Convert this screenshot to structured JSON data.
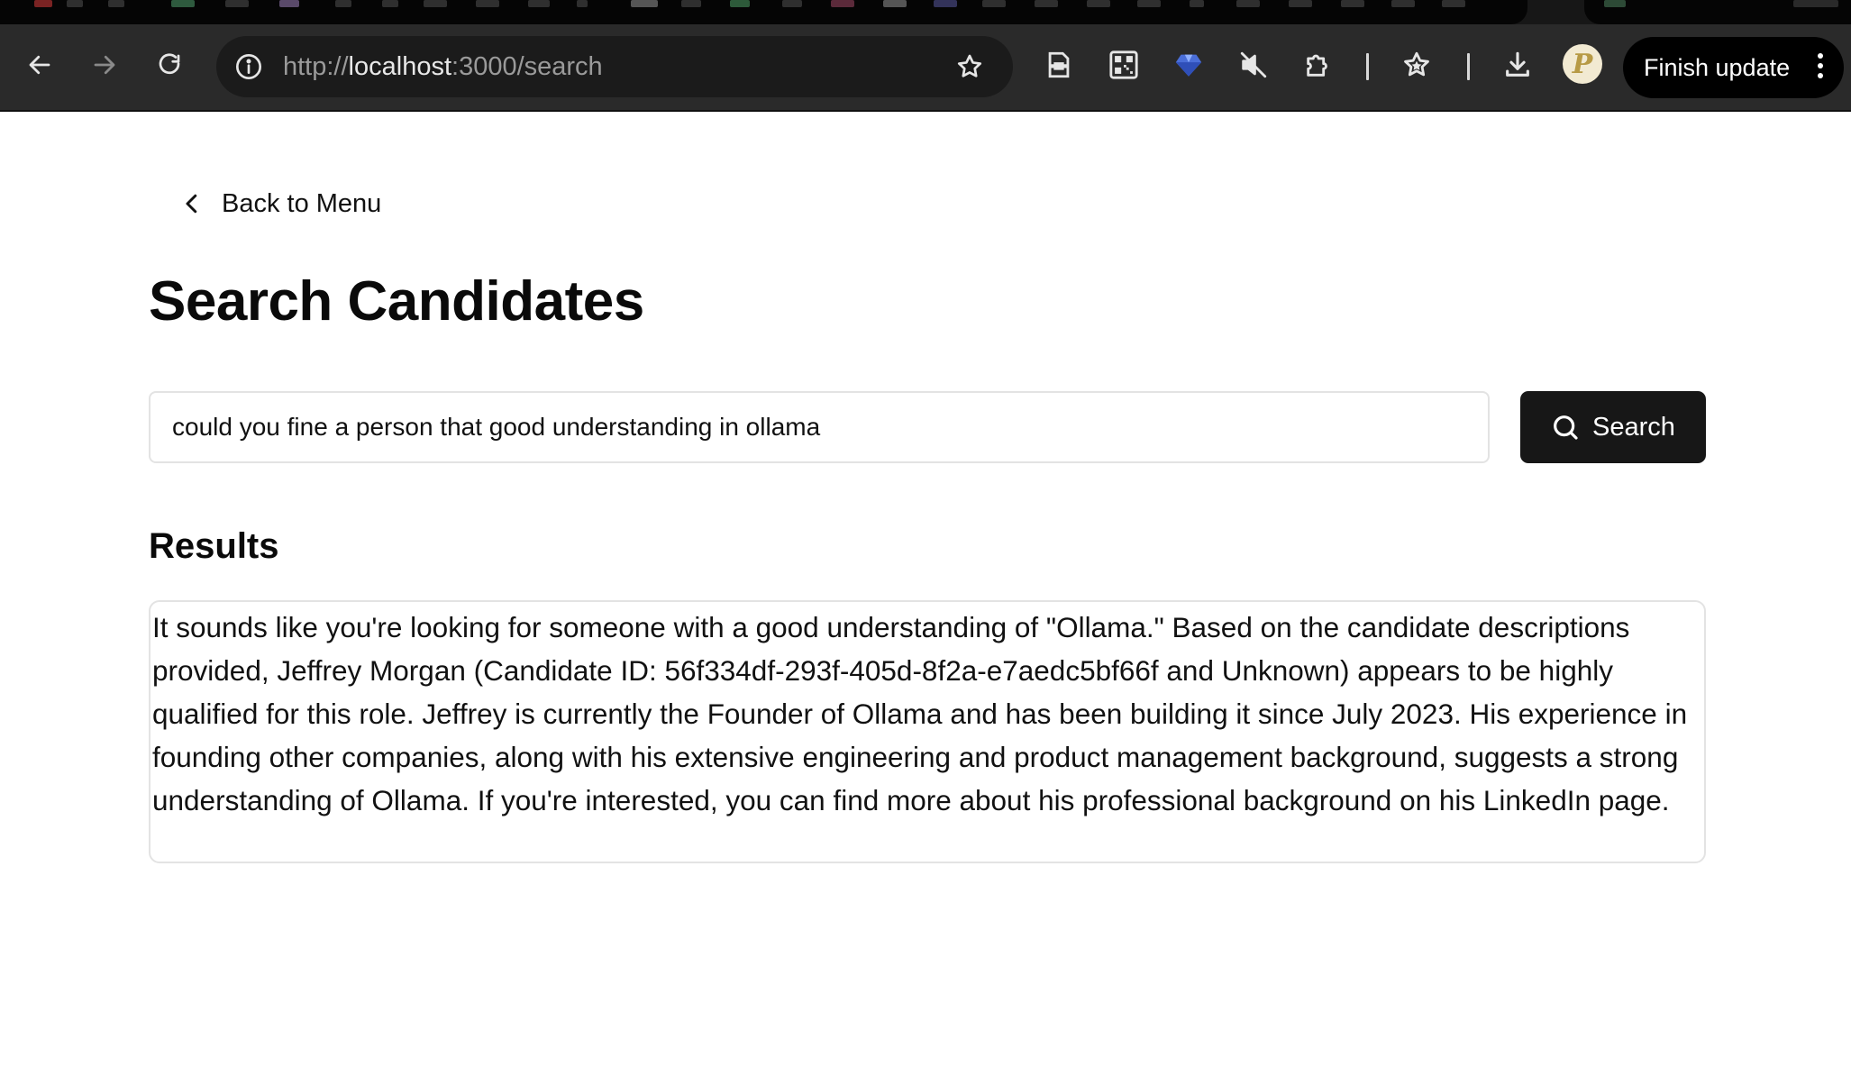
{
  "browser": {
    "url_scheme": "http://",
    "url_host": "localhost",
    "url_path": ":3000/search",
    "finish_update_label": "Finish update",
    "avatar_letter": "P",
    "icons": [
      "back-arrow-icon",
      "forward-arrow-icon",
      "reload-icon",
      "info-icon",
      "bookmark-star-icon",
      "reader-icon",
      "qr-code-icon",
      "gem-extension-icon",
      "mute-icon",
      "extensions-puzzle-icon",
      "bookmarks-icon",
      "download-icon",
      "more-vert-icon"
    ]
  },
  "page": {
    "back_label": "Back to Menu",
    "title": "Search Candidates",
    "search": {
      "value": "could you fine a person that good understanding in ollama",
      "button_label": "Search"
    },
    "results_heading": "Results",
    "results_text": "It sounds like you're looking for someone with a good understanding of \"Ollama.\" Based on the candidate descriptions provided, Jeffrey Morgan (Candidate ID: 56f334df-293f-405d-8f2a-e7aedc5bf66f and Unknown) appears to be highly qualified for this role. Jeffrey is currently the Founder of Ollama and has been building it since July 2023. His experience in founding other companies, along with his extensive engineering and product management background, suggests a strong understanding of Ollama. If you're interested, you can find more about his professional background on his LinkedIn page."
  },
  "colors": {
    "toolbar_bg": "#2a2a2a",
    "primary_button": "#171717",
    "border": "#e3e3e3",
    "text": "#111111"
  }
}
